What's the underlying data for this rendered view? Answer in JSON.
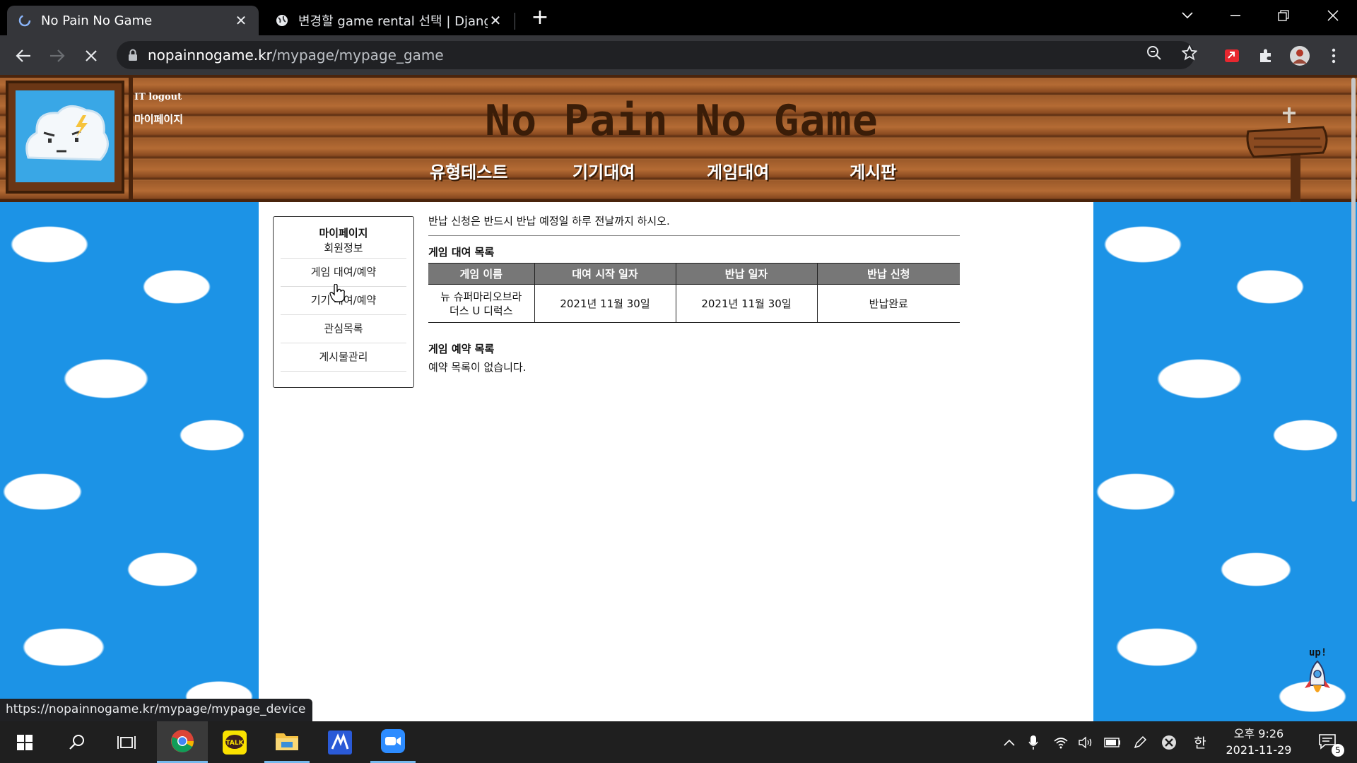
{
  "browser": {
    "tabs": [
      {
        "title": "No Pain No Game",
        "active": true
      },
      {
        "title": "변경할 game rental 선택 | Django",
        "active": false
      }
    ],
    "address": {
      "host": "nopainnogame.kr",
      "path": "/mypage/mypage_game"
    },
    "status_url": "https://nopainnogame.kr/mypage/mypage_device"
  },
  "header": {
    "user_line": "IT logout",
    "mypage_link": "마이페이지",
    "site_title": "No Pain No Game",
    "nav": [
      "유형테스트",
      "기기대여",
      "게임대여",
      "게시판"
    ]
  },
  "sidebar": {
    "title": "마이페이지",
    "items": [
      "회원정보",
      "게임 대여/예약",
      "기기 대여/예약",
      "관심목록",
      "게시물관리"
    ]
  },
  "main": {
    "notice": "반납 신청은 반드시 반납 예정일 하루 전날까지 하시오.",
    "rental_title": "게임 대여 목록",
    "rental_table": {
      "headers": [
        "게임 이름",
        "대여 시작 일자",
        "반납 일자",
        "반납 신청"
      ],
      "rows": [
        {
          "name_line1": "뉴 슈퍼마리오브라",
          "name_line2": "더스 U 디럭스",
          "start": "2021년 11월 30일",
          "return_date": "2021년 11월 30일",
          "status": "반납완료"
        }
      ]
    },
    "reservation_title": "게임 예약 목록",
    "reservation_empty": "예약 목록이 없습니다."
  },
  "floating": {
    "up_label": "up!"
  },
  "taskbar": {
    "ime": "한",
    "time": "오후 9:26",
    "date": "2021-11-29",
    "notifications": "5"
  },
  "colors": {
    "sky": "#1c93e6",
    "wood": "#b46b34",
    "table_header": "#777777"
  }
}
